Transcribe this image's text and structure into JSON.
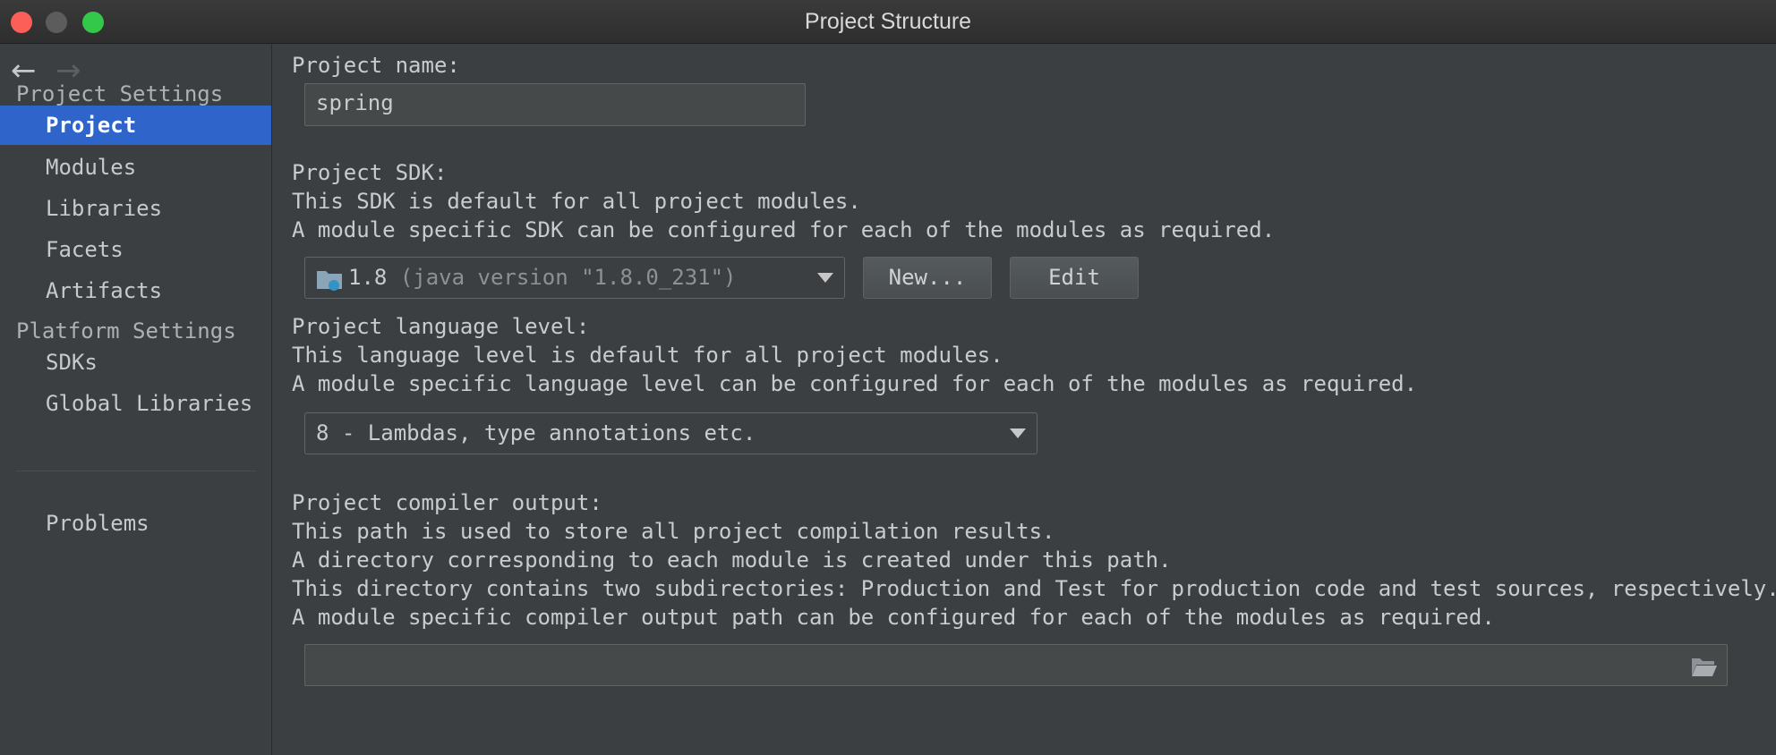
{
  "window": {
    "title": "Project Structure"
  },
  "nav": {
    "back_icon": "arrow-left-icon",
    "forward_icon": "arrow-right-icon"
  },
  "sidebar": {
    "project_settings_header": "Project Settings",
    "project_settings_items": [
      {
        "label": "Project",
        "selected": true
      },
      {
        "label": "Modules"
      },
      {
        "label": "Libraries"
      },
      {
        "label": "Facets"
      },
      {
        "label": "Artifacts"
      }
    ],
    "platform_settings_header": "Platform Settings",
    "platform_settings_items": [
      {
        "label": "SDKs"
      },
      {
        "label": "Global Libraries"
      }
    ],
    "problems_label": "Problems"
  },
  "main": {
    "project_name": {
      "label": "Project name:",
      "value": "spring"
    },
    "sdk": {
      "label": "Project SDK:",
      "line1": "This SDK is default for all project modules.",
      "line2": "A module specific SDK can be configured for each of the modules as required.",
      "selected_name": "1.8",
      "selected_detail": "(java version \"1.8.0_231\")",
      "new_button": "New...",
      "edit_button": "Edit"
    },
    "language_level": {
      "label": "Project language level:",
      "line1": "This language level is default for all project modules.",
      "line2": "A module specific language level can be configured for each of the modules as required.",
      "selected": "8 - Lambdas, type annotations etc."
    },
    "compiler_output": {
      "label": "Project compiler output:",
      "line1": "This path is used to store all project compilation results.",
      "line2": "A directory corresponding to each module is created under this path.",
      "line3": "This directory contains two subdirectories: Production and Test for production code and test sources, respectively.",
      "line4": "A module specific compiler output path can be configured for each of the modules as required.",
      "value": ""
    }
  },
  "colors": {
    "selection": "#2f65ca",
    "background": "#3c3f41",
    "close": "#fc5f57",
    "maximize": "#34c84a"
  }
}
